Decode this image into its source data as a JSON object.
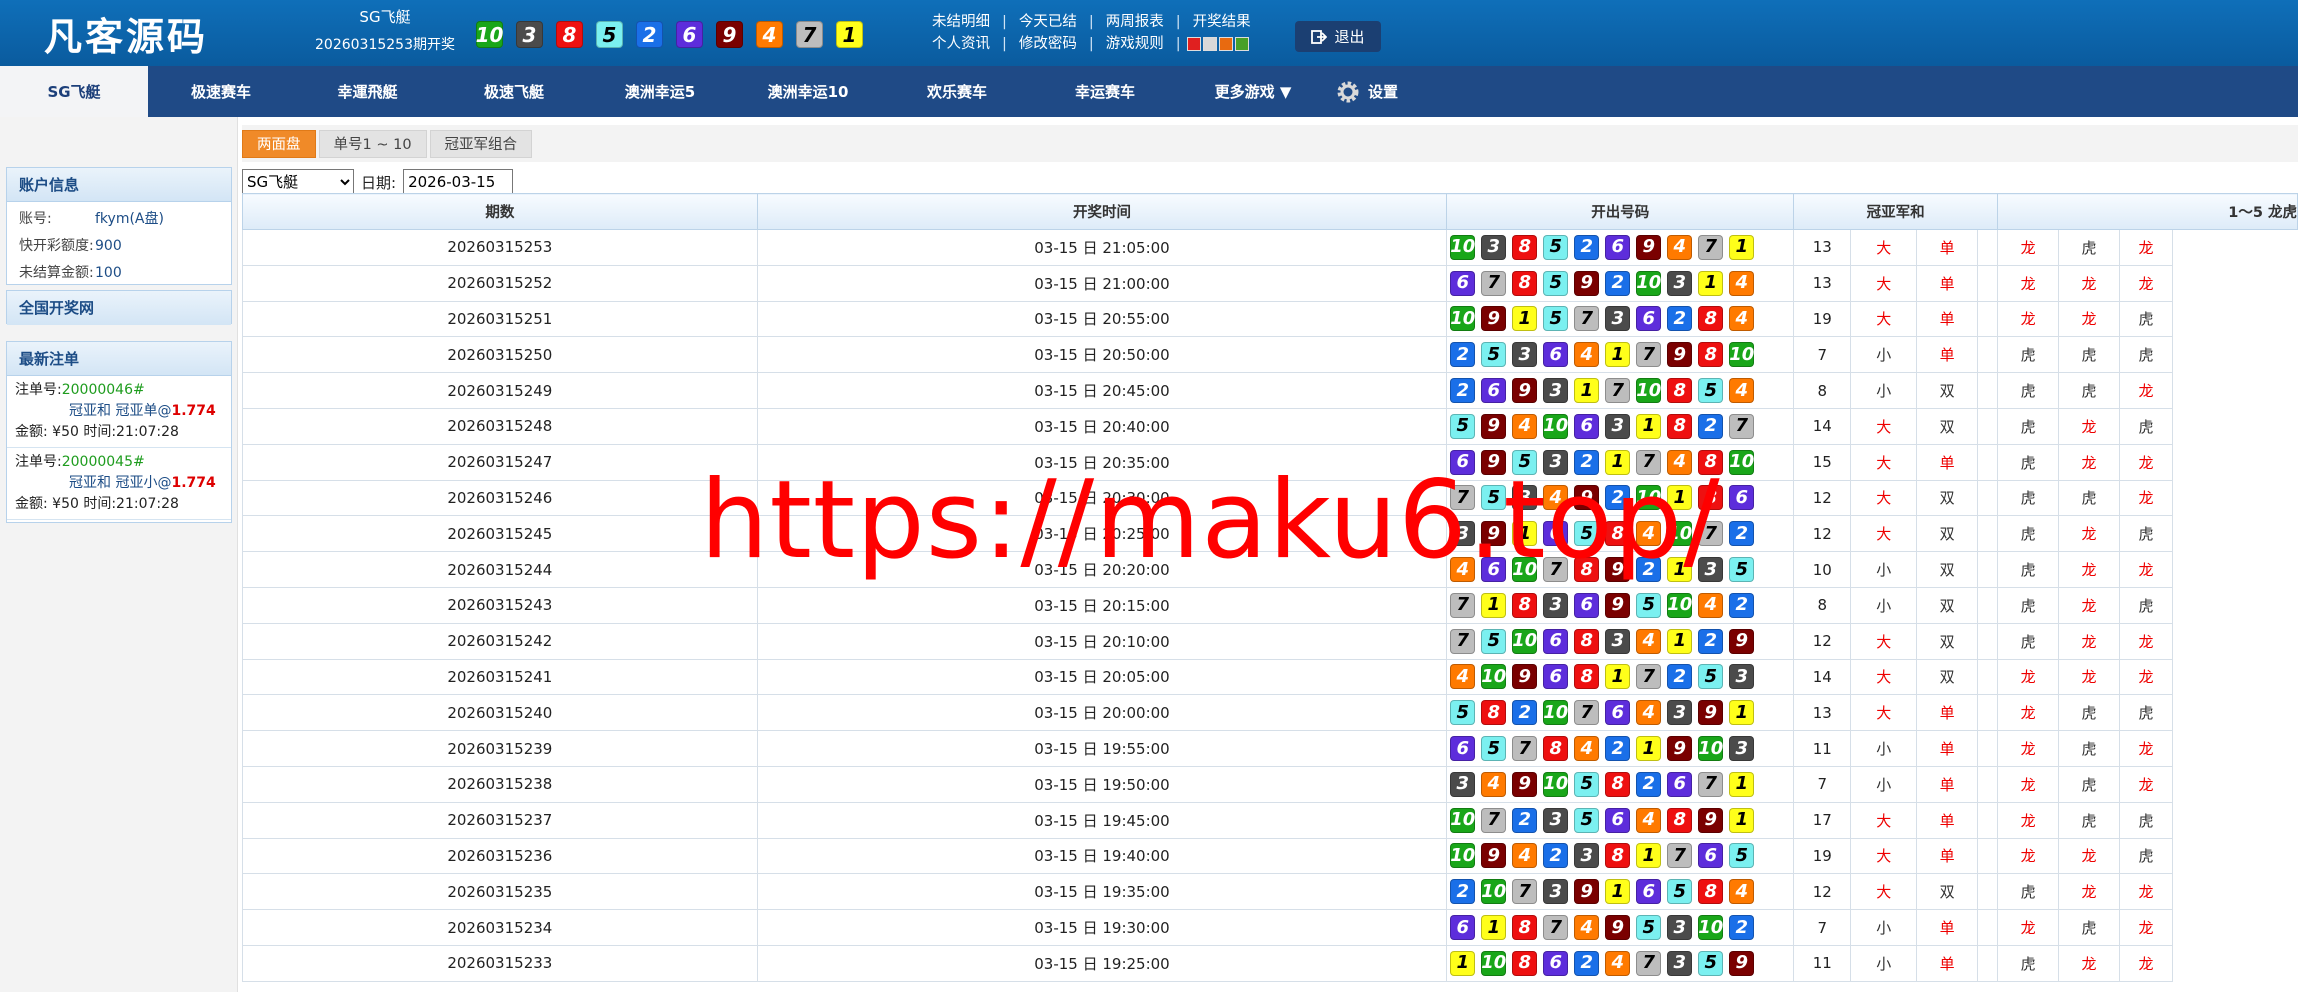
{
  "header": {
    "logo": "凡客源码",
    "current_game": "SG飞艇",
    "current_period": "20260315253期开奖",
    "latest_balls": [
      10,
      3,
      8,
      5,
      2,
      6,
      9,
      4,
      7,
      1
    ],
    "links_row1": [
      "未结明细",
      "今天已结",
      "两周报表",
      "开奖结果"
    ],
    "links_row2": [
      "个人资讯",
      "修改密码",
      "游戏规则"
    ],
    "theme_colors": [
      "#e02020",
      "#d8d8d8",
      "#e86a10",
      "#48a028"
    ],
    "logout_label": "退出"
  },
  "ball_colors": {
    "1": "#ffff1a",
    "2": "#1a6fe8",
    "3": "#4b4b4b",
    "4": "#ff7a00",
    "5": "#7bf0f0",
    "6": "#5d2ddb",
    "7": "#bdbdbd",
    "8": "#ee1010",
    "9": "#7a0000",
    "10": "#19a619"
  },
  "nav": {
    "items": [
      "SG飞艇",
      "极速赛车",
      "幸運飛艇",
      "极速飞艇",
      "澳洲幸运5",
      "澳洲幸运10",
      "欢乐赛车",
      "幸运赛车",
      "更多游戏 ▼"
    ],
    "settings": "设置"
  },
  "sidebar": {
    "account_title": "账户信息",
    "account": [
      {
        "label": "账号:",
        "value": "fkym(A盘)"
      },
      {
        "label": "快开彩额度:",
        "value": "900"
      },
      {
        "label": "未结算金额:",
        "value": "100"
      }
    ],
    "national_title": "全国开奖网",
    "bets_title": "最新注单",
    "bets": [
      {
        "no_label": "注单号:",
        "no": "20000046#",
        "desc": "冠亚和 冠亚单@",
        "odd": "1.774",
        "amount": "金额: ¥50  时间:21:07:28"
      },
      {
        "no_label": "注单号:",
        "no": "20000045#",
        "desc": "冠亚和 冠亚小@",
        "odd": "1.774",
        "amount": "金额: ¥50  时间:21:07:28"
      }
    ]
  },
  "tabs": [
    "两面盘",
    "单号1 ~ 10",
    "冠亚军组合"
  ],
  "filters": {
    "game": "SG飞艇",
    "date_label": "日期:",
    "date": "2026-03-15"
  },
  "table": {
    "headers": [
      "期数",
      "开奖时间",
      "开出号码",
      "冠亚军和",
      "1～5 龙虎"
    ],
    "rows": [
      {
        "period": "20260315253",
        "time": "03-15 日 21:05:00",
        "balls": [
          10,
          3,
          8,
          5,
          2,
          6,
          9,
          4,
          7,
          1
        ],
        "sum": "13",
        "size": "大",
        "oe": "单",
        "lh": [
          "龙",
          "虎",
          "龙"
        ]
      },
      {
        "period": "20260315252",
        "time": "03-15 日 21:00:00",
        "balls": [
          6,
          7,
          8,
          5,
          9,
          2,
          10,
          3,
          1,
          4
        ],
        "sum": "13",
        "size": "大",
        "oe": "单",
        "lh": [
          "龙",
          "龙",
          "龙"
        ]
      },
      {
        "period": "20260315251",
        "time": "03-15 日 20:55:00",
        "balls": [
          10,
          9,
          1,
          5,
          7,
          3,
          6,
          2,
          8,
          4
        ],
        "sum": "19",
        "size": "大",
        "oe": "单",
        "lh": [
          "龙",
          "龙",
          "虎"
        ]
      },
      {
        "period": "20260315250",
        "time": "03-15 日 20:50:00",
        "balls": [
          2,
          5,
          3,
          6,
          4,
          1,
          7,
          9,
          8,
          10
        ],
        "sum": "7",
        "size": "小",
        "oe": "单",
        "lh": [
          "虎",
          "虎",
          "虎"
        ]
      },
      {
        "period": "20260315249",
        "time": "03-15 日 20:45:00",
        "balls": [
          2,
          6,
          9,
          3,
          1,
          7,
          10,
          8,
          5,
          4
        ],
        "sum": "8",
        "size": "小",
        "oe": "双",
        "lh": [
          "虎",
          "虎",
          "龙"
        ]
      },
      {
        "period": "20260315248",
        "time": "03-15 日 20:40:00",
        "balls": [
          5,
          9,
          4,
          10,
          6,
          3,
          1,
          8,
          2,
          7
        ],
        "sum": "14",
        "size": "大",
        "oe": "双",
        "lh": [
          "虎",
          "龙",
          "虎"
        ]
      },
      {
        "period": "20260315247",
        "time": "03-15 日 20:35:00",
        "balls": [
          6,
          9,
          5,
          3,
          2,
          1,
          7,
          4,
          8,
          10
        ],
        "sum": "15",
        "size": "大",
        "oe": "单",
        "lh": [
          "虎",
          "龙",
          "龙"
        ]
      },
      {
        "period": "20260315246",
        "time": "03-15 日 20:30:00",
        "balls": [
          7,
          5,
          3,
          4,
          9,
          2,
          10,
          1,
          8,
          6
        ],
        "sum": "12",
        "size": "大",
        "oe": "双",
        "lh": [
          "虎",
          "虎",
          "龙"
        ]
      },
      {
        "period": "20260315245",
        "time": "03-15 日 20:25:00",
        "balls": [
          3,
          9,
          1,
          6,
          5,
          8,
          4,
          10,
          7,
          2
        ],
        "sum": "12",
        "size": "大",
        "oe": "双",
        "lh": [
          "虎",
          "龙",
          "虎"
        ]
      },
      {
        "period": "20260315244",
        "time": "03-15 日 20:20:00",
        "balls": [
          4,
          6,
          10,
          7,
          8,
          9,
          2,
          1,
          3,
          5
        ],
        "sum": "10",
        "size": "小",
        "oe": "双",
        "lh": [
          "虎",
          "龙",
          "龙"
        ]
      },
      {
        "period": "20260315243",
        "time": "03-15 日 20:15:00",
        "balls": [
          7,
          1,
          8,
          3,
          6,
          9,
          5,
          10,
          4,
          2
        ],
        "sum": "8",
        "size": "小",
        "oe": "双",
        "lh": [
          "虎",
          "龙",
          "虎"
        ]
      },
      {
        "period": "20260315242",
        "time": "03-15 日 20:10:00",
        "balls": [
          7,
          5,
          10,
          6,
          8,
          3,
          4,
          1,
          2,
          9
        ],
        "sum": "12",
        "size": "大",
        "oe": "双",
        "lh": [
          "虎",
          "龙",
          "龙"
        ]
      },
      {
        "period": "20260315241",
        "time": "03-15 日 20:05:00",
        "balls": [
          4,
          10,
          9,
          6,
          8,
          1,
          7,
          2,
          5,
          3
        ],
        "sum": "14",
        "size": "大",
        "oe": "双",
        "lh": [
          "龙",
          "龙",
          "龙"
        ]
      },
      {
        "period": "20260315240",
        "time": "03-15 日 20:00:00",
        "balls": [
          5,
          8,
          2,
          10,
          7,
          6,
          4,
          3,
          9,
          1
        ],
        "sum": "13",
        "size": "大",
        "oe": "单",
        "lh": [
          "龙",
          "虎",
          "虎"
        ]
      },
      {
        "period": "20260315239",
        "time": "03-15 日 19:55:00",
        "balls": [
          6,
          5,
          7,
          8,
          4,
          2,
          1,
          9,
          10,
          3
        ],
        "sum": "11",
        "size": "小",
        "oe": "单",
        "lh": [
          "龙",
          "虎",
          "龙"
        ]
      },
      {
        "period": "20260315238",
        "time": "03-15 日 19:50:00",
        "balls": [
          3,
          4,
          9,
          10,
          5,
          8,
          2,
          6,
          7,
          1
        ],
        "sum": "7",
        "size": "小",
        "oe": "单",
        "lh": [
          "龙",
          "虎",
          "龙"
        ]
      },
      {
        "period": "20260315237",
        "time": "03-15 日 19:45:00",
        "balls": [
          10,
          7,
          2,
          3,
          5,
          6,
          4,
          8,
          9,
          1
        ],
        "sum": "17",
        "size": "大",
        "oe": "单",
        "lh": [
          "龙",
          "虎",
          "虎"
        ]
      },
      {
        "period": "20260315236",
        "time": "03-15 日 19:40:00",
        "balls": [
          10,
          9,
          4,
          2,
          3,
          8,
          1,
          7,
          6,
          5
        ],
        "sum": "19",
        "size": "大",
        "oe": "单",
        "lh": [
          "龙",
          "龙",
          "虎"
        ]
      },
      {
        "period": "20260315235",
        "time": "03-15 日 19:35:00",
        "balls": [
          2,
          10,
          7,
          3,
          9,
          1,
          6,
          5,
          8,
          4
        ],
        "sum": "12",
        "size": "大",
        "oe": "双",
        "lh": [
          "虎",
          "龙",
          "龙"
        ]
      },
      {
        "period": "20260315234",
        "time": "03-15 日 19:30:00",
        "balls": [
          6,
          1,
          8,
          7,
          4,
          9,
          5,
          3,
          10,
          2
        ],
        "sum": "7",
        "size": "小",
        "oe": "单",
        "lh": [
          "龙",
          "虎",
          "龙"
        ]
      },
      {
        "period": "20260315233",
        "time": "03-15 日 19:25:00",
        "balls": [
          1,
          10,
          8,
          6,
          2,
          4,
          7,
          3,
          5,
          9
        ],
        "sum": "11",
        "size": "小",
        "oe": "单",
        "lh": [
          "虎",
          "龙",
          "龙"
        ]
      }
    ]
  },
  "watermark": "https://maku6.top/"
}
